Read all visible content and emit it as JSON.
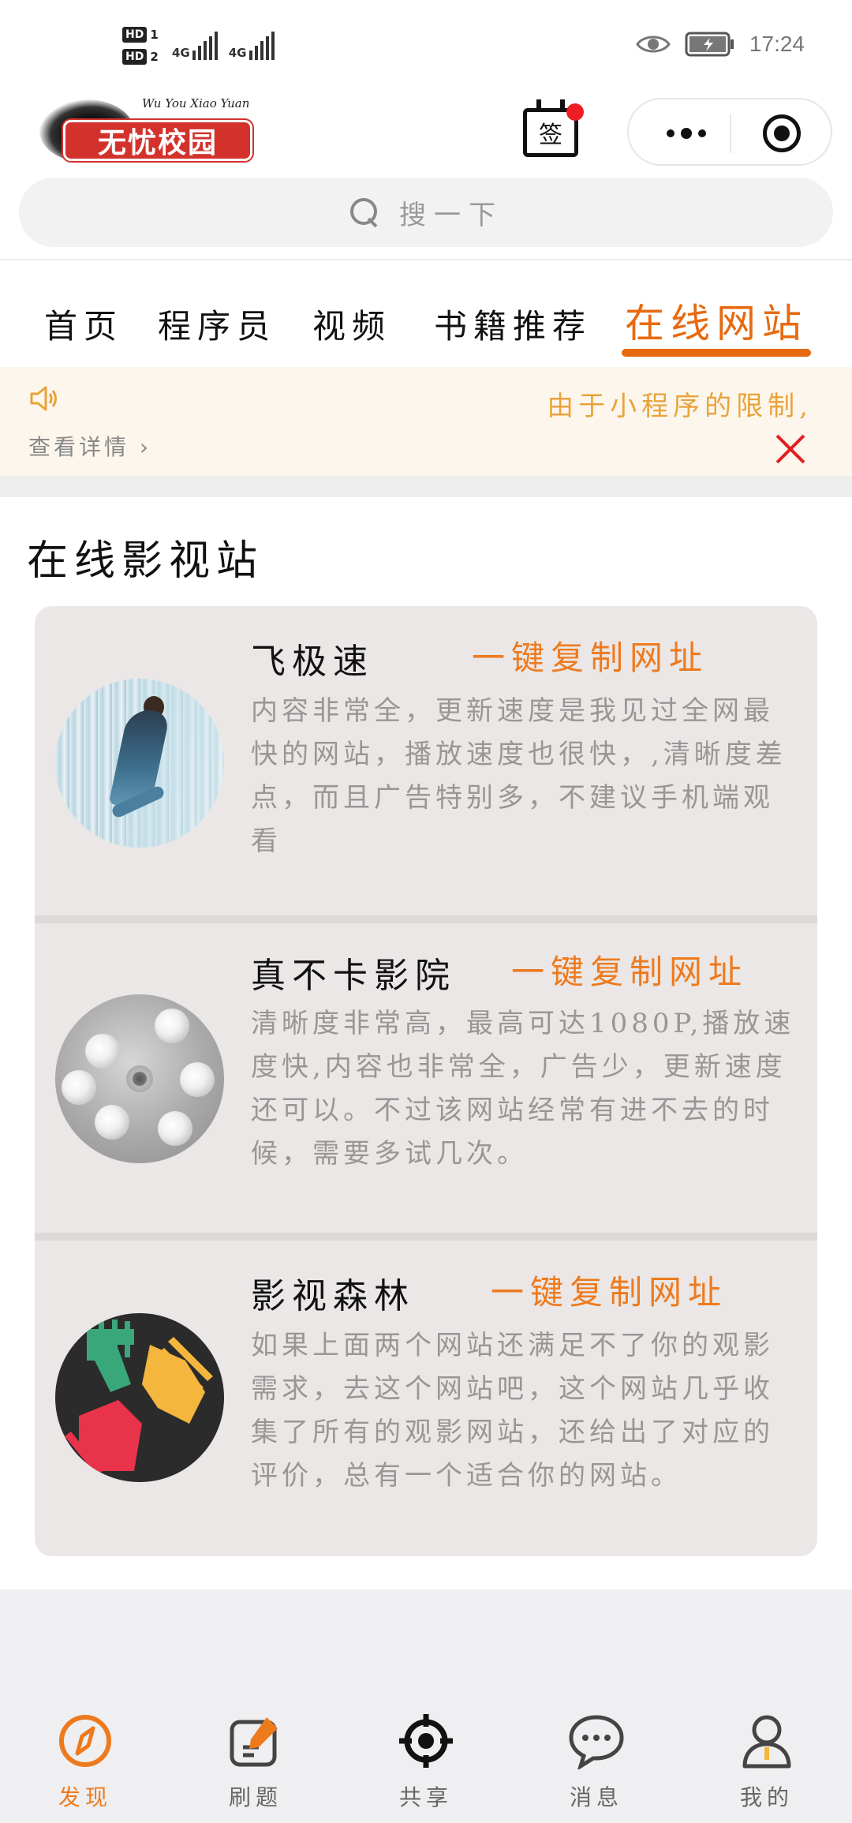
{
  "status_bar": {
    "sim1_badge": "HD",
    "sim1_num": "1",
    "sim2_badge": "HD",
    "sim2_num": "2",
    "network1": "4G",
    "network2": "4G",
    "time": "17:24"
  },
  "header": {
    "logo_text": "无忧校园",
    "logo_script": "Wu You Xiao Yuan",
    "signin_label": "签"
  },
  "search": {
    "placeholder": "搜一下"
  },
  "tabs": [
    {
      "label": "首页",
      "active": false
    },
    {
      "label": "程序员",
      "active": false
    },
    {
      "label": "视频",
      "active": false
    },
    {
      "label": "书籍推荐",
      "active": false
    },
    {
      "label": "在线网站",
      "active": true
    }
  ],
  "notice": {
    "text": "由于小程序的限制,",
    "link": "查看详情",
    "accent_color": "#e8a33a"
  },
  "section": {
    "title": "在线影视站"
  },
  "sites": [
    {
      "name": "飞极速",
      "copy_label": "一键复制网址",
      "description": "内容非常全，更新速度是我见过全网最快的网站，播放速度也很快，,清晰度差点，而且广告特别多，不建议手机端观看"
    },
    {
      "name": "真不卡影院",
      "copy_label": "一键复制网址",
      "description": "清晰度非常高，最高可达1080P,播放速度快,内容也非常全，广告少，更新速度还可以。不过该网站经常有进不去的时候，需要多试几次。"
    },
    {
      "name": "影视森林",
      "copy_label": "一键复制网址",
      "description": "如果上面两个网站还满足不了你的观影需求，去这个网站吧，这个网站几乎收集了所有的观影网站，还给出了对应的评价，总有一个适合你的网站。"
    }
  ],
  "bottom_nav": [
    {
      "label": "发现",
      "icon": "compass-icon",
      "active": true
    },
    {
      "label": "刷题",
      "icon": "edit-icon",
      "active": false
    },
    {
      "label": "共享",
      "icon": "target-icon",
      "active": false
    },
    {
      "label": "消息",
      "icon": "chat-icon",
      "active": false
    },
    {
      "label": "我的",
      "icon": "user-icon",
      "active": false
    }
  ],
  "colors": {
    "accent": "#ee7a1e",
    "tab_active": "#e86a10",
    "notice_bg": "#fdf6ec",
    "close_red": "#e02020",
    "card_bg": "#eae7e6"
  }
}
